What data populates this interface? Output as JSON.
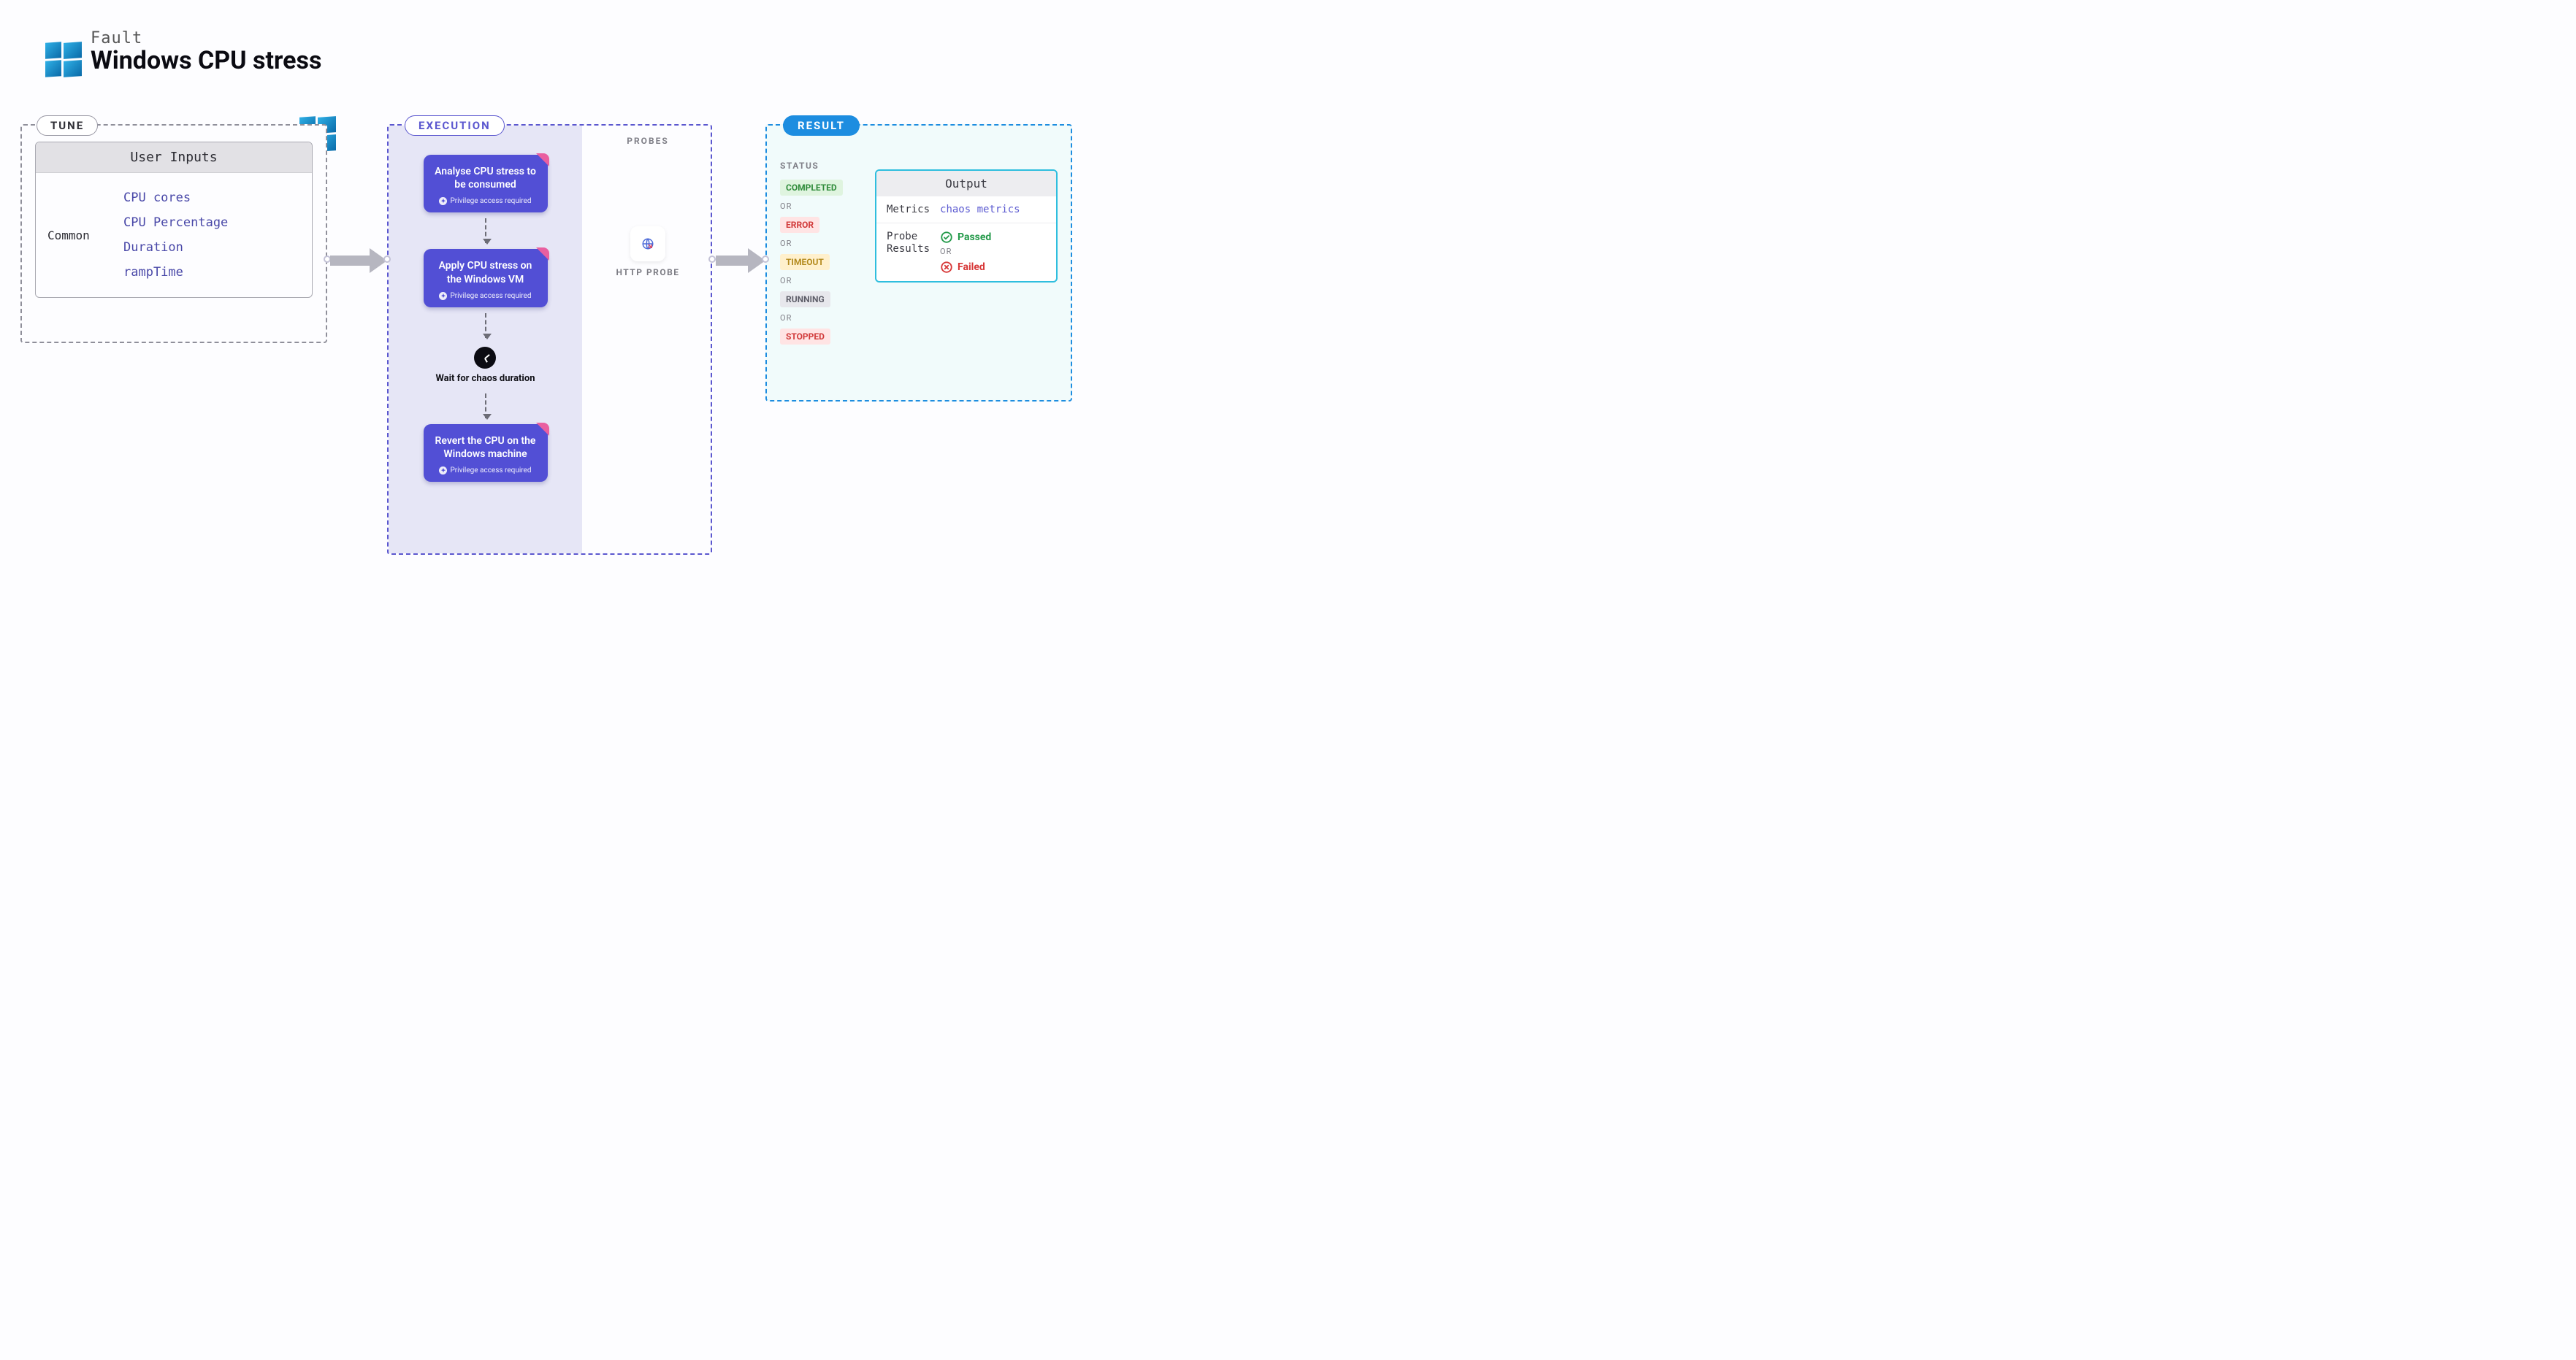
{
  "header": {
    "eyebrow": "Fault",
    "title": "Windows CPU stress"
  },
  "tune": {
    "pill": "TUNE",
    "userInputsTitle": "User Inputs",
    "group": "Common",
    "fields": [
      "CPU cores",
      "CPU Percentage",
      "Duration",
      "rampTime"
    ]
  },
  "execution": {
    "pill": "EXECUTION",
    "steps": [
      {
        "title": "Analyse CPU stress to be consumed",
        "note": "Privilege access required"
      },
      {
        "title": "Apply CPU stress on the Windows VM",
        "note": "Privilege access required"
      },
      {
        "title": "Revert the CPU on the Windows machine",
        "note": "Privilege access required"
      }
    ],
    "waitLabel": "Wait for chaos duration"
  },
  "probes": {
    "sectionLabel": "PROBES",
    "name": "HTTP PROBE"
  },
  "result": {
    "pill": "RESULT",
    "statusLabel": "STATUS",
    "or": "OR",
    "statuses": [
      "COMPLETED",
      "ERROR",
      "TIMEOUT",
      "RUNNING",
      "STOPPED"
    ],
    "output": {
      "title": "Output",
      "metricsLabel": "Metrics",
      "metricsValue": "chaos metrics",
      "probeResultsLabel1": "Probe",
      "probeResultsLabel2": "Results",
      "passed": "Passed",
      "failed": "Failed"
    }
  }
}
